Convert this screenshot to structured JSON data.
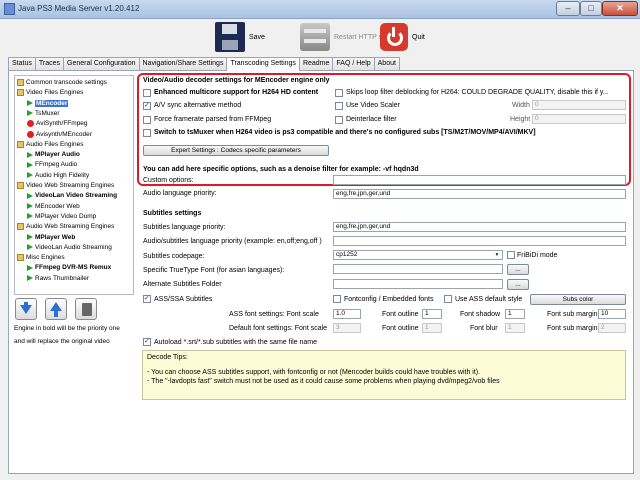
{
  "window": {
    "title": "Java PS3 Media Server v1.20.412",
    "minimize": "–",
    "maximize": "□",
    "close": "✕"
  },
  "toolbar": {
    "save": "Save",
    "restart": "Restart HTTP server",
    "quit": "Quit"
  },
  "tabs": [
    "Status",
    "Traces",
    "General Configuration",
    "Navigation/Share Settings",
    "Transcoding Settings",
    "Readme",
    "FAQ / Help",
    "About"
  ],
  "active_tab": "Transcoding Settings",
  "tree": {
    "items": [
      {
        "label": "Common transcode settings",
        "icon": "folder"
      },
      {
        "label": "Video Files Engines",
        "icon": "folder"
      },
      {
        "label": "MEncoder",
        "icon": "play",
        "bold": true,
        "selected": true
      },
      {
        "label": "TsMuxer",
        "icon": "play"
      },
      {
        "label": "AviSynth/FFmpeg",
        "icon": "stop"
      },
      {
        "label": "Avisynth/MEncoder",
        "icon": "stop"
      },
      {
        "label": "Audio Files Engines",
        "icon": "folder"
      },
      {
        "label": "MPlayer Audio",
        "icon": "play",
        "bold": true
      },
      {
        "label": "FFmpeg Audio",
        "icon": "play"
      },
      {
        "label": "Audio High Fidelity",
        "icon": "play"
      },
      {
        "label": "Video Web Streaming Engines",
        "icon": "folder"
      },
      {
        "label": "VideoLan Video Streaming",
        "icon": "play",
        "bold": true
      },
      {
        "label": "MEncoder Web",
        "icon": "play"
      },
      {
        "label": "MPlayer Video Dump",
        "icon": "play"
      },
      {
        "label": "Audio Web Streaming Engines",
        "icon": "folder"
      },
      {
        "label": "MPlayer Web",
        "icon": "play",
        "bold": true
      },
      {
        "label": "VideoLan Audio Streaming",
        "icon": "play"
      },
      {
        "label": "Misc Engines",
        "icon": "folder"
      },
      {
        "label": "FFmpeg DVR-MS Remux",
        "icon": "play",
        "bold": true
      },
      {
        "label": "Raws Thumbnailer",
        "icon": "play"
      }
    ],
    "note_line1": "Engine in bold will be the priority one",
    "note_line2": "and will replace the original video"
  },
  "decoder": {
    "title": "Video/Audio decoder settings for MEncoder engine only",
    "multicore": "Enhanced multicore support for H264 HD content",
    "skip_loop": "Skips loop filter deblocking for H264: COULD DEGRADE QUALITY, disable this if y...",
    "av_sync": "A/V sync alternative method",
    "video_scaler": "Use Video Scaler",
    "width_label": "Width",
    "width_value": "0",
    "force_framerate": "Force framerate parsed from FFMpeg",
    "deinterlace": "Deinterlace filter",
    "height_label": "Height",
    "height_value": "0",
    "tsmuxer": "Switch to tsMuxer when H264 video is ps3 compatible and there's no configured subs [TS/M2T/MOV/MP4/AVI/MKV]",
    "expert_button": "Expert Settings : Codecs specific parameters"
  },
  "custom": {
    "title": "You can add here specific options, such as a denoise filter for example: -vf hqdn3d",
    "options_label": "Custom options:",
    "options_value": "",
    "audio_priority_label": "Audio language priority:",
    "audio_priority_value": "eng,fre,jpn,ger,und"
  },
  "subs": {
    "title": "Subtitles settings",
    "lang_priority_label": "Subtitles language priority:",
    "lang_priority_value": "eng,fre,jpn,ger,und",
    "audio_sub_label": "Audio/subtitles language priority (example:  en,off;eng,off )",
    "audio_sub_value": "",
    "codepage_label": "Subtitles codepage:",
    "codepage_value": "cp1252",
    "fribidi": "FriBiDi mode",
    "font_label": "Specific TrueType Font (for asian languages):",
    "font_value": "",
    "alt_folder_label": "Alternate Subtitles Folder",
    "alt_folder_value": "",
    "browse": "...",
    "ass": "ASS/SSA Subtitles",
    "fontconfig": "Fontconfig / Embedded fonts",
    "use_ass_default": "Use ASS default style",
    "subs_color": "Subs color",
    "ass_font_label": "ASS font settings: Font scale",
    "ass_font_scale": "1.0",
    "font_outline_label": "Font outline",
    "ass_outline": "1",
    "font_shadow_label": "Font shadow",
    "ass_shadow": "1",
    "font_margin_label": "Font sub margin",
    "ass_margin": "10",
    "def_font_label": "Default font settings: Font scale",
    "def_font_scale": "3",
    "def_outline": "1",
    "font_blur_label": "Font blur",
    "def_blur": "1",
    "def_margin": "2",
    "autoload": "Autoload *.srt/*.sub subtitles with the same file name"
  },
  "tips": {
    "title": "Decode Tips:",
    "line1": "- You can choose ASS subtitles support, with fontconfig or not (Mencoder builds could have troubles with it).",
    "line2": "- The \"-lavdopts fast\" switch must not be used as it could cause some problems when playing dvd/mpeg2/vob files"
  },
  "colors": {
    "highlight": "#e0182a",
    "selection": "#3875d7",
    "tips_bg": "#fefcd6"
  }
}
